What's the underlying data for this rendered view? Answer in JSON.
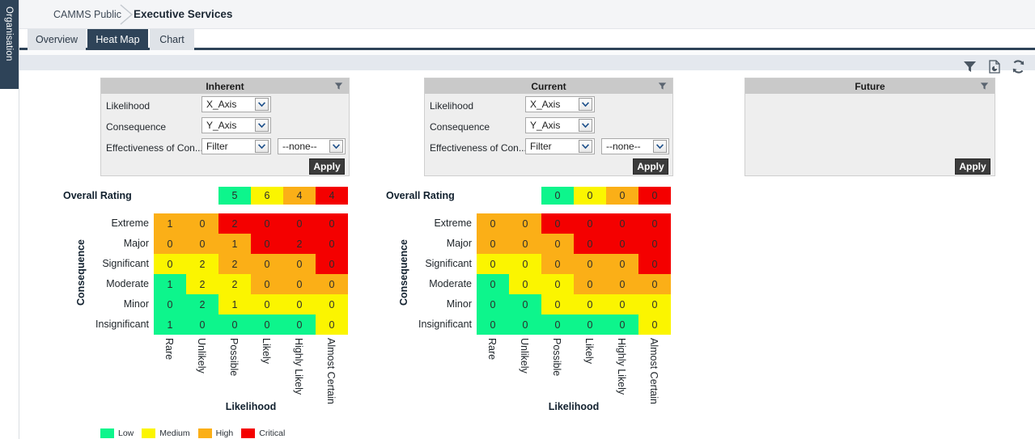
{
  "sidebar": {
    "rail_label": "Organisation"
  },
  "breadcrumb": {
    "parent": "CAMMS Public",
    "current": "Executive Services"
  },
  "tabs": [
    {
      "label": "Overview",
      "active": false
    },
    {
      "label": "Heat Map",
      "active": true
    },
    {
      "label": "Chart",
      "active": false
    }
  ],
  "toolbar": {
    "filter_title": "Filter",
    "report_title": "Report",
    "refresh_title": "Refresh"
  },
  "panels": [
    {
      "title": "Inherent",
      "fields": [
        {
          "label": "Likelihood",
          "value": "X_Axis"
        },
        {
          "label": "Consequence",
          "value": "Y_Axis"
        },
        {
          "label": "Effectiveness of Con...",
          "value": "Filter",
          "value2": "--none--"
        }
      ],
      "apply_label": "Apply"
    },
    {
      "title": "Current",
      "fields": [
        {
          "label": "Likelihood",
          "value": "X_Axis"
        },
        {
          "label": "Consequence",
          "value": "Y_Axis"
        },
        {
          "label": "Effectiveness of Con...",
          "value": "Filter",
          "value2": "--none--"
        }
      ],
      "apply_label": "Apply"
    },
    {
      "title": "Future",
      "fields": [],
      "apply_label": "Apply"
    }
  ],
  "colors": {
    "low": "#0df58c",
    "medium": "#fbf500",
    "high": "#fbaf17",
    "critical": "#f40000",
    "accent_navy": "#2e4358",
    "panel_head": "#c9c9c9",
    "panel_body": "#eeeeee"
  },
  "legend": [
    {
      "label": "Low",
      "color": "#0df58c"
    },
    {
      "label": "Medium",
      "color": "#fbf500"
    },
    {
      "label": "High",
      "color": "#fbaf17"
    },
    {
      "label": "Critical",
      "color": "#f40000"
    }
  ],
  "chart_data": [
    {
      "type": "heatmap",
      "title": "Inherent",
      "xlabel": "Likelihood",
      "ylabel": "Consequence",
      "overall_rating_label": "Overall Rating",
      "overall_rating": {
        "categories": [
          "Low",
          "Medium",
          "High",
          "Critical"
        ],
        "values": [
          5,
          6,
          4,
          4
        ],
        "colors": [
          "#0df58c",
          "#fbf500",
          "#fbaf17",
          "#f40000"
        ]
      },
      "x": [
        "Rare",
        "Unlikely",
        "Possible",
        "Likely",
        "Highly Likely",
        "Almost Certain"
      ],
      "y": [
        "Extreme",
        "Major",
        "Significant",
        "Moderate",
        "Minor",
        "Insignificant"
      ],
      "values": [
        [
          1,
          0,
          2,
          0,
          0,
          0
        ],
        [
          0,
          0,
          1,
          0,
          2,
          0
        ],
        [
          0,
          2,
          2,
          0,
          0,
          0
        ],
        [
          1,
          2,
          2,
          0,
          0,
          0
        ],
        [
          0,
          2,
          1,
          0,
          0,
          0
        ],
        [
          1,
          0,
          0,
          0,
          0,
          0
        ]
      ],
      "cell_colors": [
        [
          "#fbaf17",
          "#fbaf17",
          "#f40000",
          "#f40000",
          "#f40000",
          "#f40000"
        ],
        [
          "#fbaf17",
          "#fbaf17",
          "#fbaf17",
          "#f40000",
          "#f40000",
          "#f40000"
        ],
        [
          "#fbf500",
          "#fbf500",
          "#fbaf17",
          "#fbaf17",
          "#fbaf17",
          "#f40000"
        ],
        [
          "#0df58c",
          "#fbf500",
          "#fbf500",
          "#fbaf17",
          "#fbaf17",
          "#fbaf17"
        ],
        [
          "#0df58c",
          "#0df58c",
          "#fbf500",
          "#fbf500",
          "#fbf500",
          "#fbf500"
        ],
        [
          "#0df58c",
          "#0df58c",
          "#0df58c",
          "#0df58c",
          "#0df58c",
          "#fbf500"
        ]
      ]
    },
    {
      "type": "heatmap",
      "title": "Current",
      "xlabel": "Likelihood",
      "ylabel": "Consequence",
      "overall_rating_label": "Overall Rating",
      "overall_rating": {
        "categories": [
          "Low",
          "Medium",
          "High",
          "Critical"
        ],
        "values": [
          0,
          0,
          0,
          0
        ],
        "colors": [
          "#0df58c",
          "#fbf500",
          "#fbaf17",
          "#f40000"
        ]
      },
      "x": [
        "Rare",
        "Unlikely",
        "Possible",
        "Likely",
        "Highly Likely",
        "Almost Certain"
      ],
      "y": [
        "Extreme",
        "Major",
        "Significant",
        "Moderate",
        "Minor",
        "Insignificant"
      ],
      "values": [
        [
          0,
          0,
          0,
          0,
          0,
          0
        ],
        [
          0,
          0,
          0,
          0,
          0,
          0
        ],
        [
          0,
          0,
          0,
          0,
          0,
          0
        ],
        [
          0,
          0,
          0,
          0,
          0,
          0
        ],
        [
          0,
          0,
          0,
          0,
          0,
          0
        ],
        [
          0,
          0,
          0,
          0,
          0,
          0
        ]
      ],
      "cell_colors": [
        [
          "#fbaf17",
          "#fbaf17",
          "#f40000",
          "#f40000",
          "#f40000",
          "#f40000"
        ],
        [
          "#fbaf17",
          "#fbaf17",
          "#fbaf17",
          "#f40000",
          "#f40000",
          "#f40000"
        ],
        [
          "#fbf500",
          "#fbf500",
          "#fbaf17",
          "#fbaf17",
          "#fbaf17",
          "#f40000"
        ],
        [
          "#0df58c",
          "#fbf500",
          "#fbf500",
          "#fbaf17",
          "#fbaf17",
          "#fbaf17"
        ],
        [
          "#0df58c",
          "#0df58c",
          "#fbf500",
          "#fbf500",
          "#fbf500",
          "#fbf500"
        ],
        [
          "#0df58c",
          "#0df58c",
          "#0df58c",
          "#0df58c",
          "#0df58c",
          "#fbf500"
        ]
      ]
    }
  ]
}
